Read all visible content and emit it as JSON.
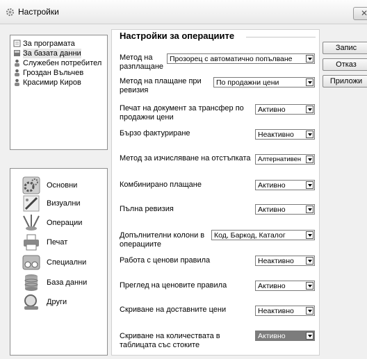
{
  "window": {
    "title": "Настройки",
    "close_glyph": "✕"
  },
  "tree": {
    "items": [
      {
        "label": "За програмата",
        "icon": "document-icon"
      },
      {
        "label": "За базата данни",
        "icon": "database-icon",
        "selected": true
      },
      {
        "label": "Служебен потребител",
        "icon": "user-icon"
      },
      {
        "label": "Гроздан Въльчев",
        "icon": "user-icon"
      },
      {
        "label": "Красимир Киров",
        "icon": "user-icon"
      }
    ]
  },
  "categories": {
    "items": [
      {
        "label": "Основни",
        "icon": "gears-icon"
      },
      {
        "label": "Визуални",
        "icon": "brush-icon"
      },
      {
        "label": "Операции",
        "icon": "operations-icon"
      },
      {
        "label": "Печат",
        "icon": "printer-icon"
      },
      {
        "label": "Специални",
        "icon": "special-icon"
      },
      {
        "label": "База данни",
        "icon": "database-stack-icon"
      },
      {
        "label": "Други",
        "icon": "magnifier-icon"
      }
    ]
  },
  "settings": {
    "title": "Настройки за операциите",
    "rows": [
      {
        "label": "Метод на разплащане",
        "value": "Прозорец с автоматично попълване"
      },
      {
        "label": "Метод на плащане при ревизия",
        "value": "По продажни цени"
      },
      {
        "label": "Печат на документ за трансфер по продажни цени",
        "value": "Активно"
      },
      {
        "label": "Бързо фактуриране",
        "value": "Неактивно"
      },
      {
        "label": "Метод за изчисляване на отстъпката",
        "value": "Алтернативен"
      },
      {
        "label": "Комбинирано плащане",
        "value": "Активно"
      },
      {
        "label": "Пълна ревизия",
        "value": "Активно"
      },
      {
        "label": "Допълнителни колони в операциите",
        "value": "Код, Баркод, Каталог"
      },
      {
        "label": "Работа с ценови правила",
        "value": "Неактивно"
      },
      {
        "label": "Преглед на ценовите правила",
        "value": "Активно"
      },
      {
        "label": "Скриване на доставните цени",
        "value": "Неактивно"
      },
      {
        "label": "Скриване на количествата в таблицата със стоките",
        "value": "Активно"
      }
    ]
  },
  "buttons": {
    "save": "Запис",
    "cancel": "Отказ",
    "apply": "Приложи"
  }
}
